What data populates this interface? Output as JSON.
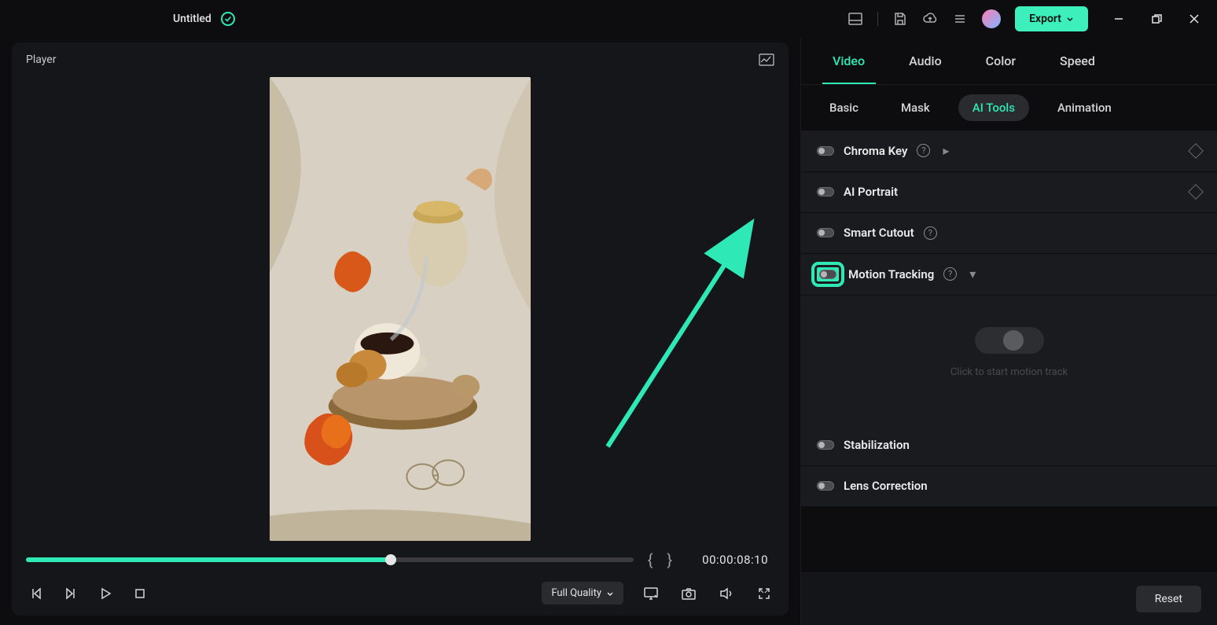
{
  "titlebar": {
    "title": "Untitled",
    "export_label": "Export"
  },
  "player": {
    "title": "Player",
    "timecode": "00:00:08:10",
    "progress_percent": 60,
    "quality_label": "Full Quality"
  },
  "right_panel": {
    "primary_tabs": [
      "Video",
      "Audio",
      "Color",
      "Speed"
    ],
    "primary_active": 0,
    "secondary_tabs": [
      "Basic",
      "Mask",
      "AI Tools",
      "Animation"
    ],
    "secondary_active": 2,
    "tools": [
      {
        "label": "Chroma Key",
        "help": true,
        "chevron": true,
        "diamond": true
      },
      {
        "label": "AI Portrait",
        "help": false,
        "chevron": false,
        "diamond": true
      },
      {
        "label": "Smart Cutout",
        "help": true,
        "chevron": false,
        "diamond": false
      },
      {
        "label": "Motion Tracking",
        "help": true,
        "chevron": true,
        "diamond": false,
        "highlighted": true,
        "expanded": true
      }
    ],
    "motion_hint": "Click to start motion track",
    "tools_after": [
      {
        "label": "Stabilization"
      },
      {
        "label": "Lens Correction"
      }
    ],
    "reset_label": "Reset"
  }
}
